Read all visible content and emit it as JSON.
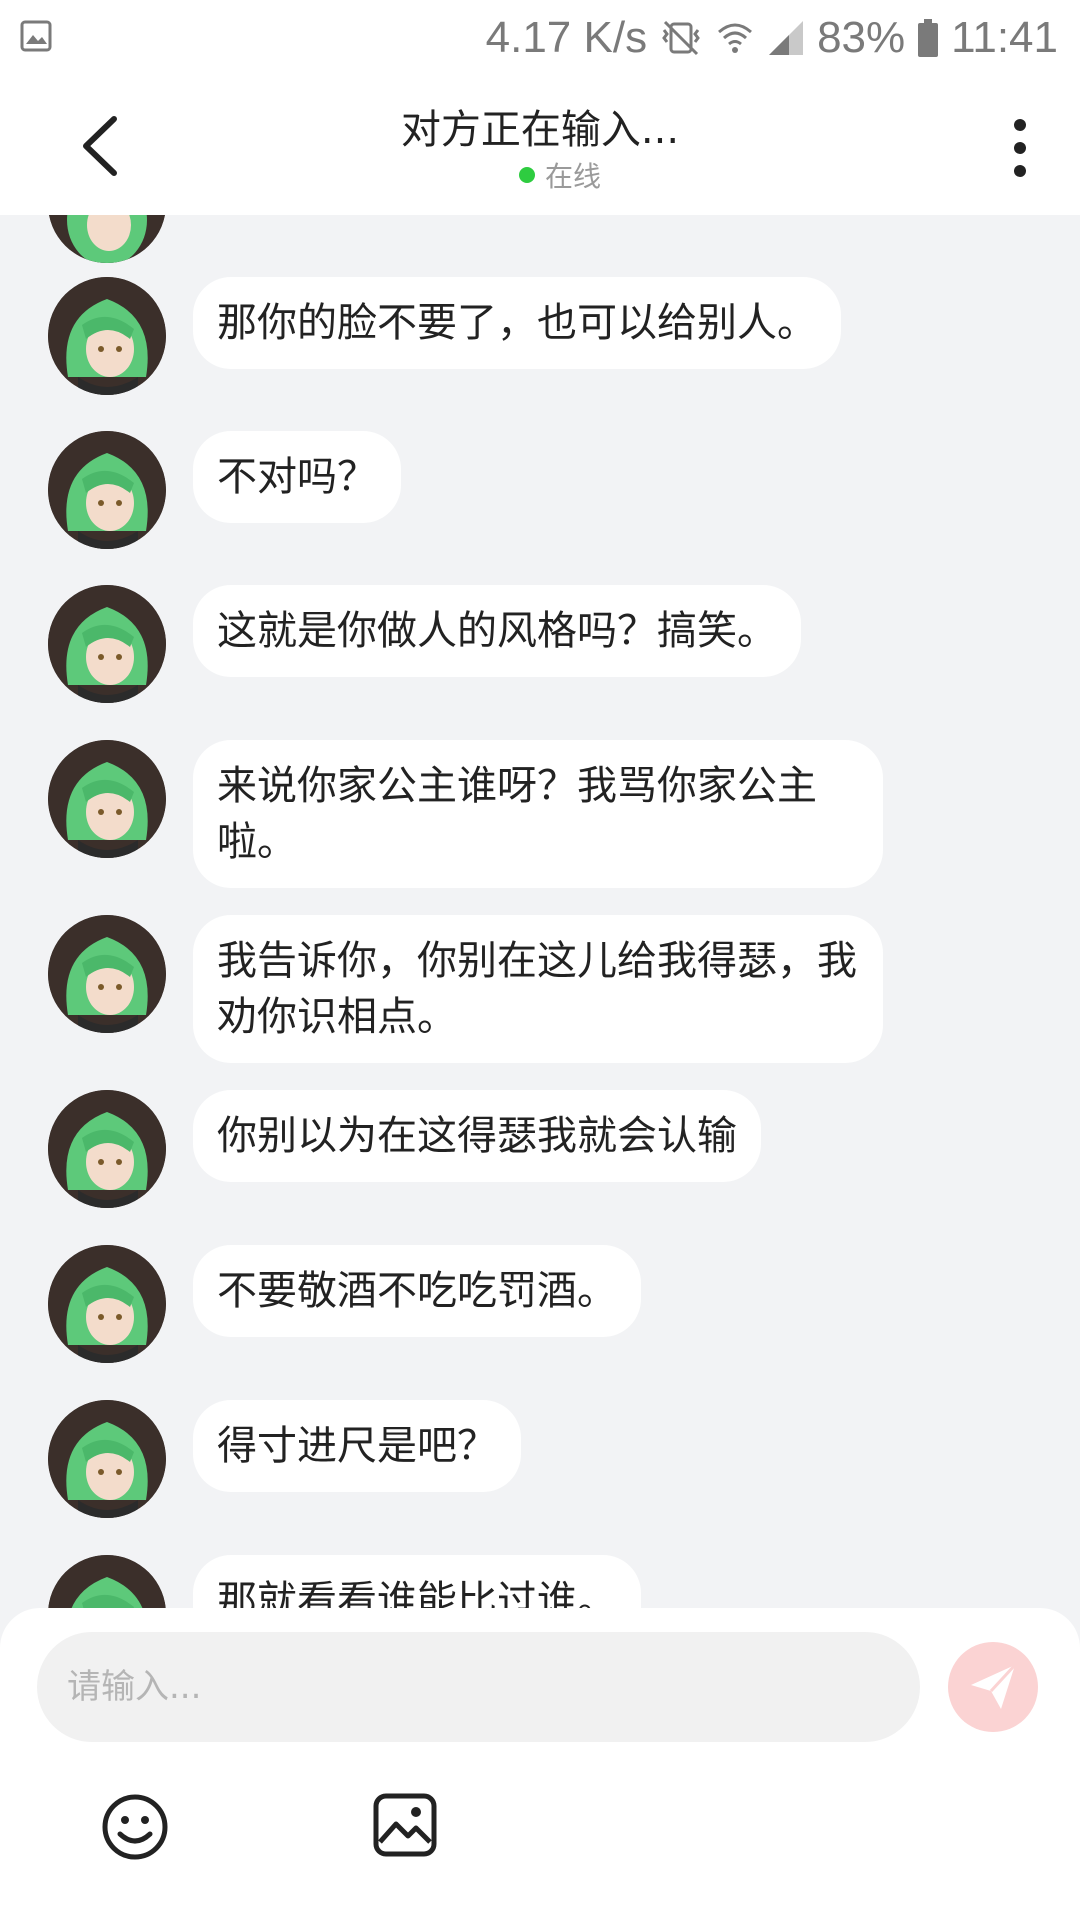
{
  "status_bar": {
    "network_speed": "4.17 K/s",
    "battery": "83%",
    "time": "11:41"
  },
  "header": {
    "title": "对方正在输入...",
    "presence": "在线"
  },
  "messages": [
    {
      "text": "那你的脸不要了，也可以给别人。"
    },
    {
      "text": "不对吗？"
    },
    {
      "text": "这就是你做人的风格吗？搞笑。"
    },
    {
      "text": "来说你家公主谁呀？我骂你家公主啦。"
    },
    {
      "text": "我告诉你，你别在这儿给我得瑟，我劝你识相点。"
    },
    {
      "text": "你别以为在这得瑟我就会认输"
    },
    {
      "text": "不要敬酒不吃吃罚酒。"
    },
    {
      "text": "得寸进尺是吧？"
    },
    {
      "text": "那就看看谁能比过谁。"
    }
  ],
  "composer": {
    "placeholder": "请输入..."
  },
  "colors": {
    "background": "#f2f3f5",
    "bubble": "#ffffff",
    "online": "#2ecc40",
    "send_button": "#fbd3d3"
  },
  "icons": {
    "back": "chevron-left-icon",
    "more": "more-vertical-icon",
    "send": "send-plane-icon",
    "emoji": "smiley-icon",
    "image": "image-icon"
  }
}
